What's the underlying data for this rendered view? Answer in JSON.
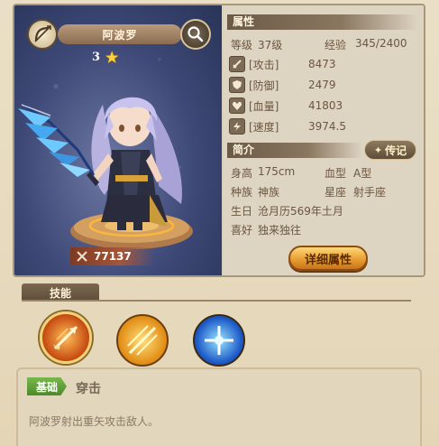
{
  "hero": {
    "name": "阿波罗",
    "stars": "3",
    "power": "77137",
    "class_icon": "bow-icon"
  },
  "attributes": {
    "title": "属性",
    "level_label": "等级",
    "level_value": "37级",
    "exp_label": "经验",
    "exp_value": "345/2400",
    "stats": [
      {
        "label": "[攻击]",
        "value": "8473",
        "icon": "sword-icon"
      },
      {
        "label": "[防御]",
        "value": "2479",
        "icon": "shield-icon"
      },
      {
        "label": "[血量]",
        "value": "41803",
        "icon": "heart-icon"
      },
      {
        "label": "[速度]",
        "value": "3974.5",
        "icon": "lightning-icon"
      }
    ]
  },
  "profile": {
    "title": "简介",
    "bio_button": "传记",
    "height_label": "身高",
    "height_value": "175cm",
    "blood_label": "血型",
    "blood_value": "A型",
    "race_label": "种族",
    "race_value": "神族",
    "sign_label": "星座",
    "sign_value": "射手座",
    "birthday_label": "生日",
    "birthday_value": "沧月历569年土月",
    "hobby_label": "喜好",
    "hobby_value": "独来独往",
    "detail_button": "详细属性"
  },
  "skills": {
    "tab_label": "技能",
    "selected": {
      "tier": "基础",
      "name": "穿击",
      "description": "阿波罗射出重矢攻击敌人。"
    },
    "icons": [
      "arrow-strike-icon",
      "light-rays-icon",
      "blue-cross-icon"
    ]
  },
  "colors": {
    "accent_gold": "#e59a2d",
    "tier_green": "#5a9a34",
    "background": "#e9dcc0"
  }
}
